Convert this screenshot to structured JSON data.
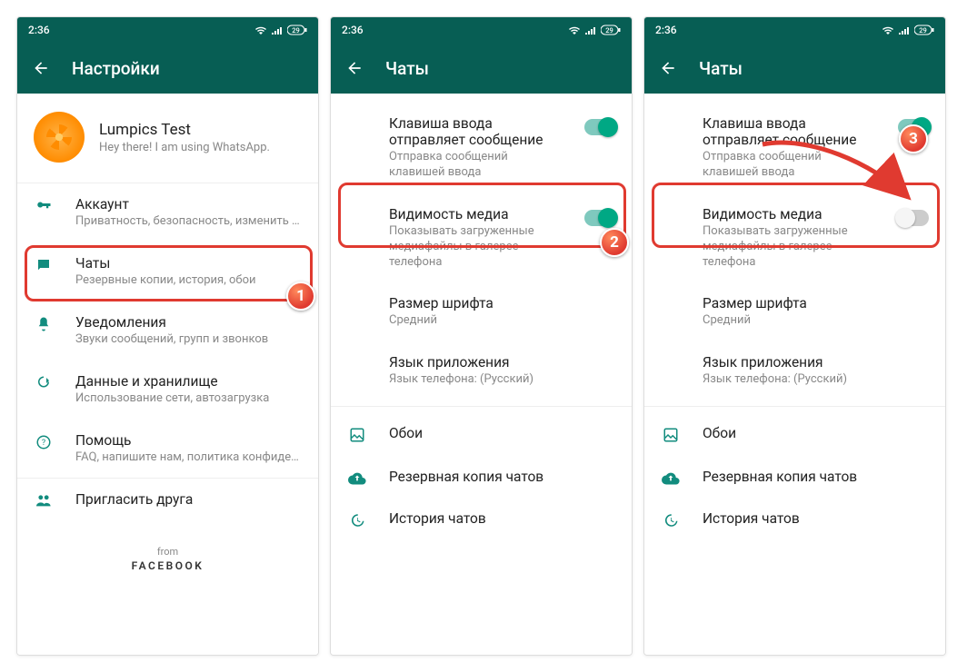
{
  "status": {
    "time": "2:36",
    "battery": "29"
  },
  "screen1": {
    "title": "Настройки",
    "profile": {
      "name": "Lumpics Test",
      "status": "Hey there! I am using WhatsApp."
    },
    "items": [
      {
        "title": "Аккаунт",
        "sub": "Приватность, безопасность, изменить номер"
      },
      {
        "title": "Чаты",
        "sub": "Резервные копии, история, обои"
      },
      {
        "title": "Уведомления",
        "sub": "Звуки сообщений, групп и звонков"
      },
      {
        "title": "Данные и хранилище",
        "sub": "Использование сети, автозагрузка"
      },
      {
        "title": "Помощь",
        "sub": "FAQ, напишите нам, политика конфиденциаль..."
      },
      {
        "title": "Пригласить друга",
        "sub": ""
      }
    ],
    "from": {
      "label": "from",
      "brand": "FACEBOOK"
    }
  },
  "screen2": {
    "title": "Чаты",
    "settings": [
      {
        "title": "Клавиша ввода отправляет сообщение",
        "sub": "Отправка сообщений клавишей ввода"
      },
      {
        "title": "Видимость медиа",
        "sub": "Показывать загруженные медиафайлы в галерее телефона"
      },
      {
        "title": "Размер шрифта",
        "sub": "Средний"
      },
      {
        "title": "Язык приложения",
        "sub": "Язык телефона: (Русский)"
      }
    ],
    "actions": [
      {
        "title": "Обои"
      },
      {
        "title": "Резервная копия чатов"
      },
      {
        "title": "История чатов"
      }
    ]
  },
  "screen3": {
    "title": "Чаты",
    "settings": [
      {
        "title": "Клавиша ввода отправляет сообщение",
        "sub": "Отправка сообщений клавишей ввода"
      },
      {
        "title": "Видимость медиа",
        "sub": "Показывать загруженные медиафайлы в галерее телефона"
      },
      {
        "title": "Размер шрифта",
        "sub": "Средний"
      },
      {
        "title": "Язык приложения",
        "sub": "Язык телефона: (Русский)"
      }
    ],
    "actions": [
      {
        "title": "Обои"
      },
      {
        "title": "Резервная копия чатов"
      },
      {
        "title": "История чатов"
      }
    ]
  },
  "callouts": {
    "b1": "1",
    "b2": "2",
    "b3": "3"
  }
}
